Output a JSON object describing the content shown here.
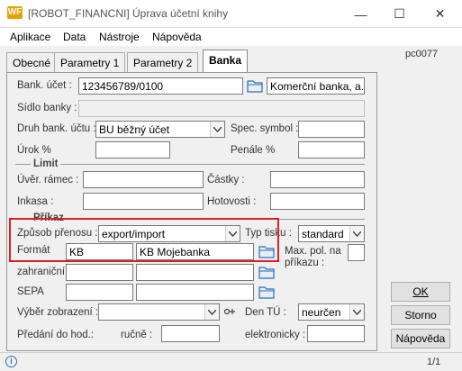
{
  "window": {
    "icon_text": "WF",
    "title": "[ROBOT_FINANCNI] Úprava účetní knihy",
    "minimize": "—",
    "maximize": "☐",
    "close": "✕"
  },
  "menu": [
    "Aplikace",
    "Data",
    "Nástroje",
    "Nápověda"
  ],
  "tabs": [
    "Obecné",
    "Parametry 1",
    "Parametry 2",
    "Banka"
  ],
  "active_tab": "Banka",
  "form_code": "pc0077",
  "fields": {
    "bank_account": {
      "label": "Bank. účet :",
      "value": "123456789/0100",
      "bank_name": "Komerční banka, a.s"
    },
    "bank_seat": {
      "label": "Sídlo banky :",
      "value": ""
    },
    "account_type": {
      "label": "Druh bank. účtu :",
      "value": "BU běžný účet"
    },
    "spec_symbol": {
      "label": "Spec. symbol :",
      "value": ""
    },
    "interest": {
      "label": "Úrok %",
      "value": ""
    },
    "penalty": {
      "label": "Penále %",
      "value": ""
    }
  },
  "limit": {
    "title": "Limit",
    "credit_frame": {
      "label": "Úvěr. rámec :",
      "value": ""
    },
    "amounts": {
      "label": "Částky :",
      "value": ""
    },
    "collection": {
      "label": "Inkasa :",
      "value": ""
    },
    "cash": {
      "label": "Hotovosti :",
      "value": ""
    }
  },
  "order": {
    "title": "Příkaz",
    "transfer_method": {
      "label": "Způsob přenosu :",
      "value": "export/import"
    },
    "print_type": {
      "label": "Typ tisku :",
      "value": "standard"
    },
    "format": {
      "label": "Formát",
      "code": "KB",
      "name": "KB Mojebanka"
    },
    "max_items": {
      "label_line1": "Max. pol. na",
      "label_line2": "příkazu :"
    },
    "foreign": {
      "label": "zahraniční"
    },
    "sepa": {
      "label": "SEPA"
    },
    "view_selection": {
      "label": "Výběr zobrazení :",
      "value": ""
    },
    "day_tu": {
      "label": "Den TÚ :",
      "value": "neurčen"
    },
    "handover": {
      "label": "Předání do hod.:",
      "manual_label": "ručně :",
      "electronic_label": "elektronicky :"
    }
  },
  "buttons": {
    "ok": "OK",
    "cancel": "Storno",
    "help": "Nápověda"
  },
  "status": {
    "info_icon": "i",
    "page": "1/1"
  },
  "colors": {
    "highlight_border": "#d81f2a",
    "accent": "#e8a000"
  }
}
